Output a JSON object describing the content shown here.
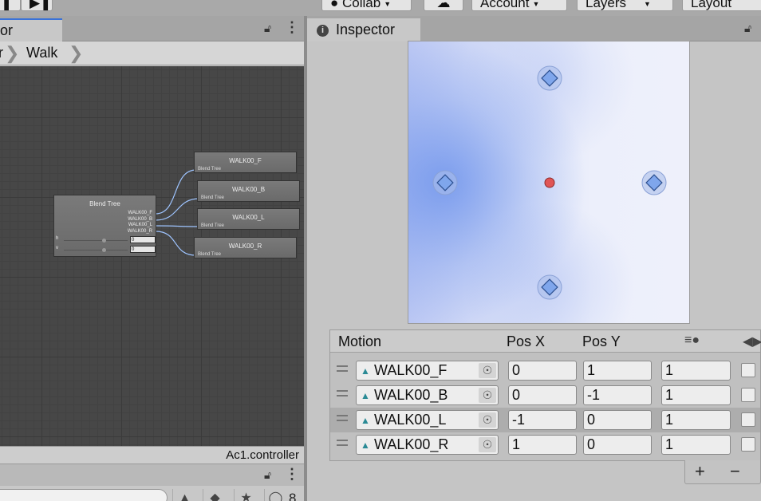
{
  "toolbar": {
    "collab_label": "Collab",
    "account_label": "Account",
    "layers_label": "Layers",
    "layout_label": "Layout"
  },
  "animator": {
    "tab_label": "or",
    "breadcrumb": [
      "r",
      "Walk"
    ],
    "controller_name": "Ac1.controller",
    "blend_tree_node": {
      "title": "Blend Tree",
      "outputs": [
        "WALK00_F",
        "WALK00_B",
        "WALK00_L",
        "WALK00_R"
      ],
      "params": [
        {
          "name": "h",
          "value": "0"
        },
        {
          "name": "v",
          "value": "0"
        }
      ]
    },
    "clip_nodes": [
      {
        "title": "WALK00_F",
        "subtitle": "Blend Tree"
      },
      {
        "title": "WALK00_B",
        "subtitle": "Blend Tree"
      },
      {
        "title": "WALK00_L",
        "subtitle": "Blend Tree"
      },
      {
        "title": "WALK00_R",
        "subtitle": "Blend Tree"
      }
    ]
  },
  "project": {
    "hidden_count": "8"
  },
  "inspector": {
    "tab_label": "Inspector",
    "columns": {
      "motion": "Motion",
      "pos_x": "Pos X",
      "pos_y": "Pos Y"
    },
    "motions": [
      {
        "clip": "WALK00_F",
        "pos_x": "0",
        "pos_y": "1",
        "speed": "1",
        "mirror": false,
        "selected": false
      },
      {
        "clip": "WALK00_B",
        "pos_x": "0",
        "pos_y": "-1",
        "speed": "1",
        "mirror": false,
        "selected": false
      },
      {
        "clip": "WALK00_L",
        "pos_x": "-1",
        "pos_y": "0",
        "speed": "1",
        "mirror": false,
        "selected": true
      },
      {
        "clip": "WALK00_R",
        "pos_x": "1",
        "pos_y": "0",
        "speed": "1",
        "mirror": false,
        "selected": false
      }
    ],
    "add_label": "+",
    "remove_label": "−"
  },
  "colors": {
    "tab_accent": "#3a72d8",
    "blend_sample": "#7fa6ec",
    "blend_current": "#e05555",
    "graph_bg": "#474747"
  }
}
